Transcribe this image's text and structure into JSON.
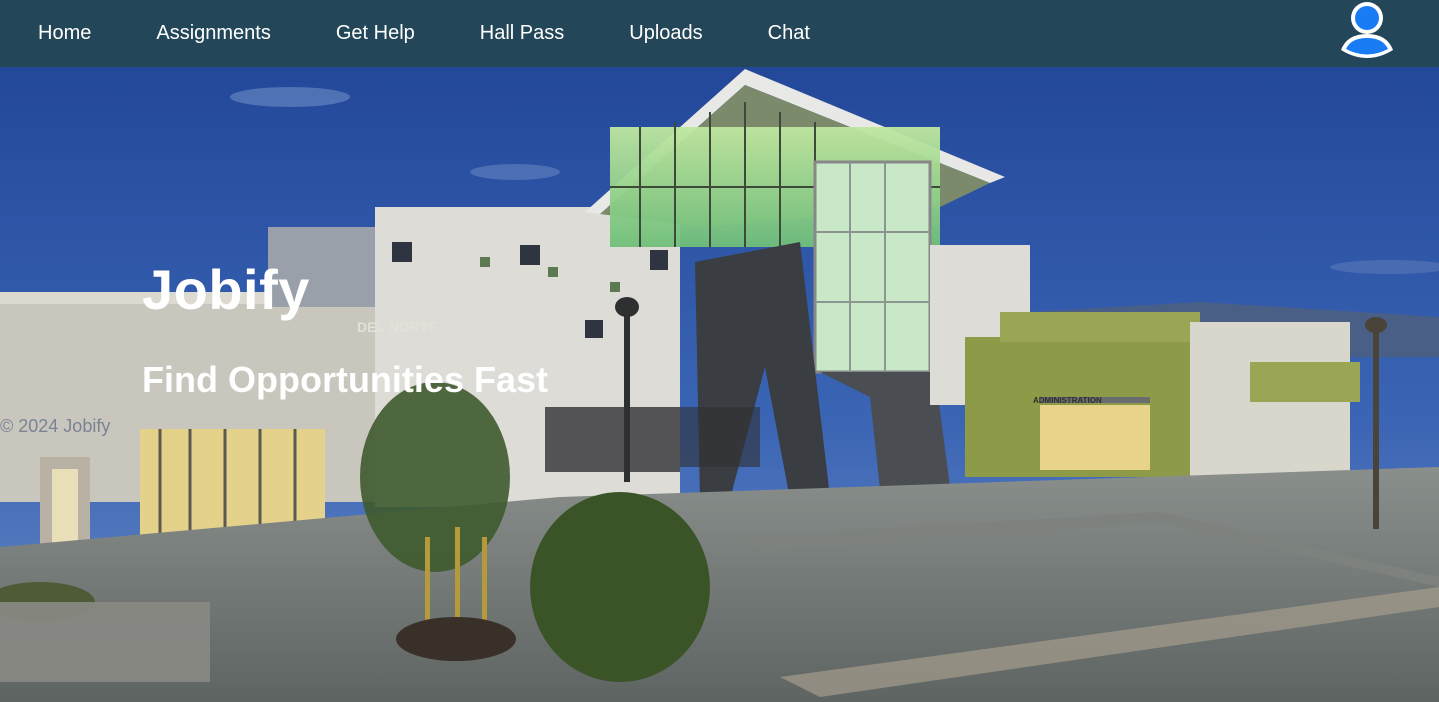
{
  "nav": {
    "items": [
      {
        "label": "Home"
      },
      {
        "label": "Assignments"
      },
      {
        "label": "Get Help"
      },
      {
        "label": "Hall Pass"
      },
      {
        "label": "Uploads"
      },
      {
        "label": "Chat"
      }
    ],
    "avatar_icon": "user-avatar-icon",
    "background_color": "#234758",
    "avatar_color": "#1a7cf5"
  },
  "hero": {
    "title": "Jobify",
    "subtitle": "Find Opportunities Fast",
    "image_signage": {
      "building_sign": "DEL NORTE",
      "admin_sign": "ADMINISTRATION"
    }
  },
  "footer": {
    "copyright": "© 2024 Jobify"
  }
}
